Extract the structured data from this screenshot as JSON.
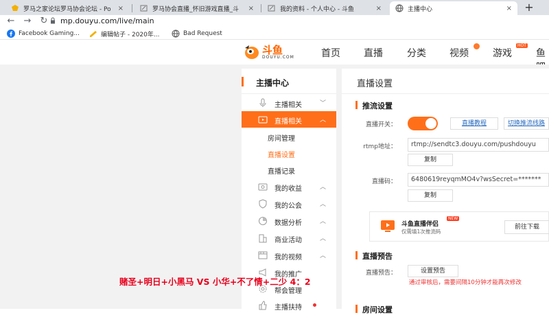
{
  "browser": {
    "tabs": [
      {
        "title": "罗马之家论坛罗马协会论坛 - Po",
        "active": false
      },
      {
        "title": "罗马协会直播_怀旧游戏直播_斗",
        "active": false
      },
      {
        "title": "我的资料 - 个人中心 - 斗鱼",
        "active": false
      },
      {
        "title": "主播中心",
        "active": true
      }
    ],
    "new_tab": "+",
    "close_glyph": "×",
    "url": "mp.douyu.com/live/main",
    "bookmarks": [
      {
        "label": "Facebook Gaming...",
        "icon": "facebook-icon"
      },
      {
        "label": "编辑帖子 - 2020年...",
        "icon": "edit-icon"
      },
      {
        "label": "Bad Request",
        "icon": "globe-icon"
      }
    ]
  },
  "site": {
    "logo_text": "斗鱼",
    "logo_sub": "DOUYU.COM",
    "nav": [
      "首页",
      "直播",
      "分类",
      "视频",
      "游戏",
      "鱼吧"
    ],
    "hot_badge": "HOT",
    "accent": "#ff6f1a"
  },
  "sidebar": {
    "title": "主播中心",
    "items": [
      {
        "label": "主播相关",
        "icon": "mic-icon",
        "arrow": "﹀"
      },
      {
        "label": "直播相关",
        "icon": "tv-icon",
        "arrow": "︿",
        "active": true
      },
      {
        "label": "我的收益",
        "icon": "money-icon",
        "arrow": "︿"
      },
      {
        "label": "我的公会",
        "icon": "shield-icon",
        "arrow": "︿"
      },
      {
        "label": "数据分析",
        "icon": "pie-chart-icon",
        "arrow": "︿"
      },
      {
        "label": "商业活动",
        "icon": "building-icon",
        "arrow": "︿"
      },
      {
        "label": "我的视频",
        "icon": "video-icon",
        "arrow": "︿"
      },
      {
        "label": "我的推广",
        "icon": "megaphone-icon",
        "arrow": ""
      },
      {
        "label": "帮会管理",
        "icon": "gear-icon",
        "arrow": ""
      },
      {
        "label": "主播扶持",
        "icon": "thumb-icon",
        "arrow": ""
      }
    ],
    "subitems": [
      {
        "label": "房间管理"
      },
      {
        "label": "直播设置",
        "active": true
      },
      {
        "label": "直播记录"
      }
    ]
  },
  "panel": {
    "title": "直播设置",
    "push_section": "推流设置",
    "toggle_label": "直播开关：",
    "tutorial_link": "直播教程",
    "switch_link": "切换推流线路",
    "rtmp_label": "rtmp地址：",
    "rtmp_value": "rtmp://sendtc3.douyu.com/pushdouyu",
    "copy_label": "复制",
    "code_label": "直播码：",
    "code_value": "6480619reyqmMO4v?wsSecret=*******",
    "promo": {
      "title": "斗鱼直播伴侣",
      "badge": "NEW",
      "subtitle": "仅需填1次推流码",
      "button": "前往下载"
    },
    "preview_section": "直播预告",
    "preview_label": "直播预告：",
    "preview_button": "设置预告",
    "preview_warning": "通过审核后，需要间隔10分钟才能再次修改",
    "next_section": "房间设置"
  },
  "overlay": {
    "text": "赌圣+明日+小黑马 VS 小华+不了情+二少  4：2"
  }
}
